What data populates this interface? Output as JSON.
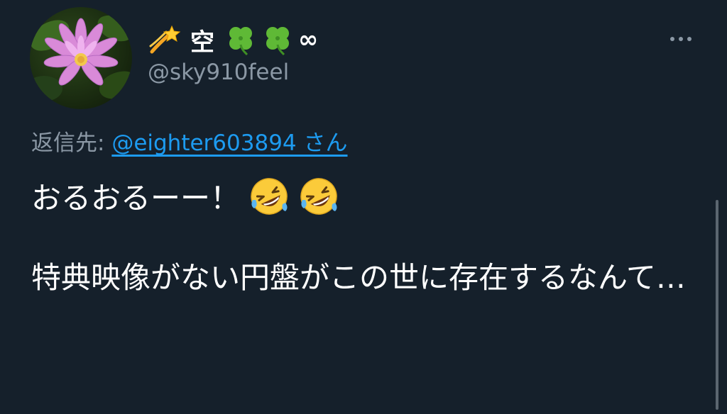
{
  "tweet": {
    "display_name": "空",
    "name_emoji_prefix": "dizzy-comet-emoji",
    "name_emoji_suffix": [
      "four-leaf-clover-emoji",
      "four-leaf-clover-emoji"
    ],
    "name_suffix_symbol": "∞",
    "handle": "@sky910feel",
    "avatar": "water-lily-photo",
    "more_icon": "more-options-icon",
    "reply_prefix": "返信先: ",
    "reply_target": "@eighter603894 さん",
    "line1_text": "おるおるーー！",
    "line1_emojis": [
      "rolling-on-floor-laughing-emoji",
      "rolling-on-floor-laughing-emoji"
    ],
    "body": "特典映像がない円盤がこの世に存在するなんて…"
  },
  "colors": {
    "background": "#15202b",
    "text_primary": "#ffffff",
    "text_secondary": "#8b98a5",
    "link": "#1d9bf0"
  }
}
